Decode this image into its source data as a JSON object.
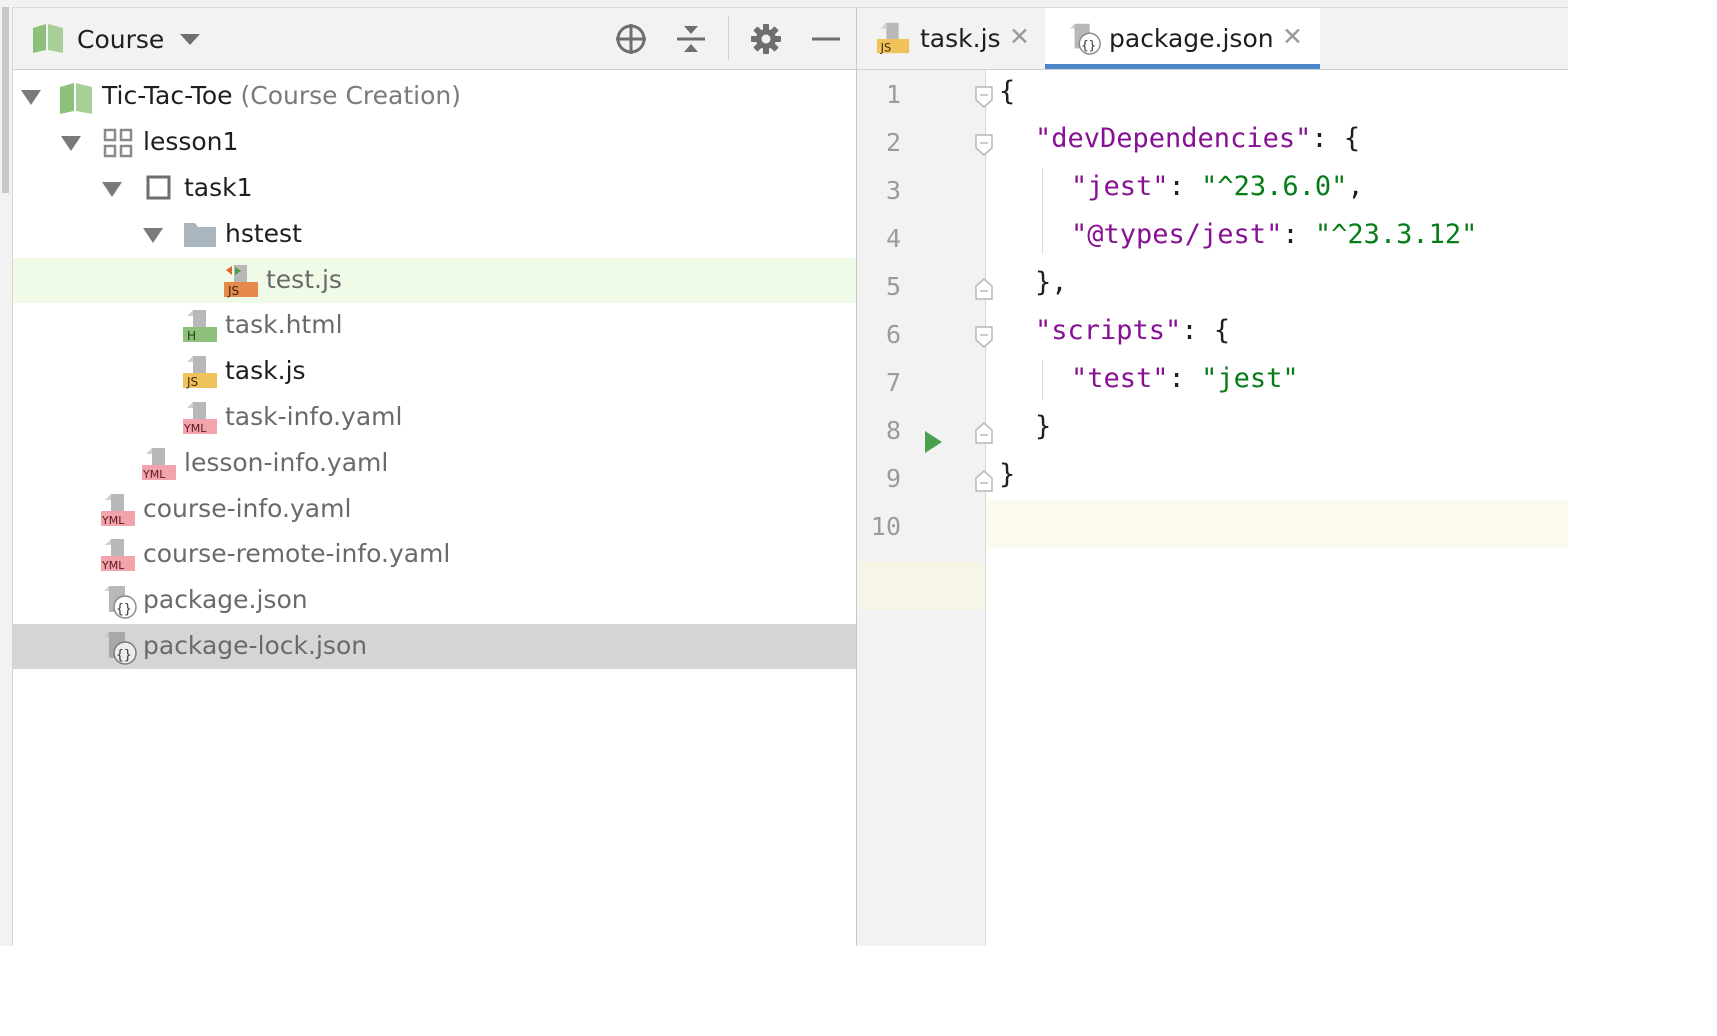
{
  "project_panel": {
    "title": "Course",
    "tree": [
      {
        "label": "Tic-Tac-Toe",
        "suffix": "(Course Creation)",
        "icon": "course-book-icon"
      },
      {
        "label": "lesson1",
        "icon": "lesson-grid-icon"
      },
      {
        "label": "task1",
        "icon": "task-square-icon"
      },
      {
        "label": "hstest",
        "icon": "folder-icon"
      },
      {
        "label": "test.js",
        "icon": "js-test-file-icon"
      },
      {
        "label": "task.html",
        "icon": "html-file-icon"
      },
      {
        "label": "task.js",
        "icon": "js-file-icon"
      },
      {
        "label": "task-info.yaml",
        "icon": "yaml-file-icon"
      },
      {
        "label": "lesson-info.yaml",
        "icon": "yaml-file-icon"
      },
      {
        "label": "course-info.yaml",
        "icon": "yaml-file-icon"
      },
      {
        "label": "course-remote-info.yaml",
        "icon": "yaml-file-icon"
      },
      {
        "label": "package.json",
        "icon": "json-file-icon"
      },
      {
        "label": "package-lock.json",
        "icon": "json-file-icon"
      }
    ]
  },
  "editor": {
    "tabs": [
      {
        "label": "task.js",
        "active": false
      },
      {
        "label": "package.json",
        "active": true
      }
    ],
    "line_numbers": [
      "1",
      "2",
      "3",
      "4",
      "5",
      "6",
      "7",
      "8",
      "9",
      "10"
    ],
    "code": {
      "l1": "{",
      "l2_key": "\"devDependencies\"",
      "l2_rest": ": {",
      "l3_key": "\"jest\"",
      "l3_sep": ": ",
      "l3_val": "\"^23.6.0\"",
      "l3_end": ",",
      "l4_key": "\"@types/jest\"",
      "l4_sep": ": ",
      "l4_val": "\"^23.3.12\"",
      "l5": "},",
      "l6_key": "\"scripts\"",
      "l6_rest": ": {",
      "l7_key": "\"test\"",
      "l7_sep": ": ",
      "l7_val": "\"jest\"",
      "l8": "}",
      "l9": "}"
    }
  },
  "colors": {
    "accent_tab_underline": "#4a86c8",
    "json_key": "#871094",
    "json_string": "#067d17",
    "selected_row": "#effae7"
  }
}
